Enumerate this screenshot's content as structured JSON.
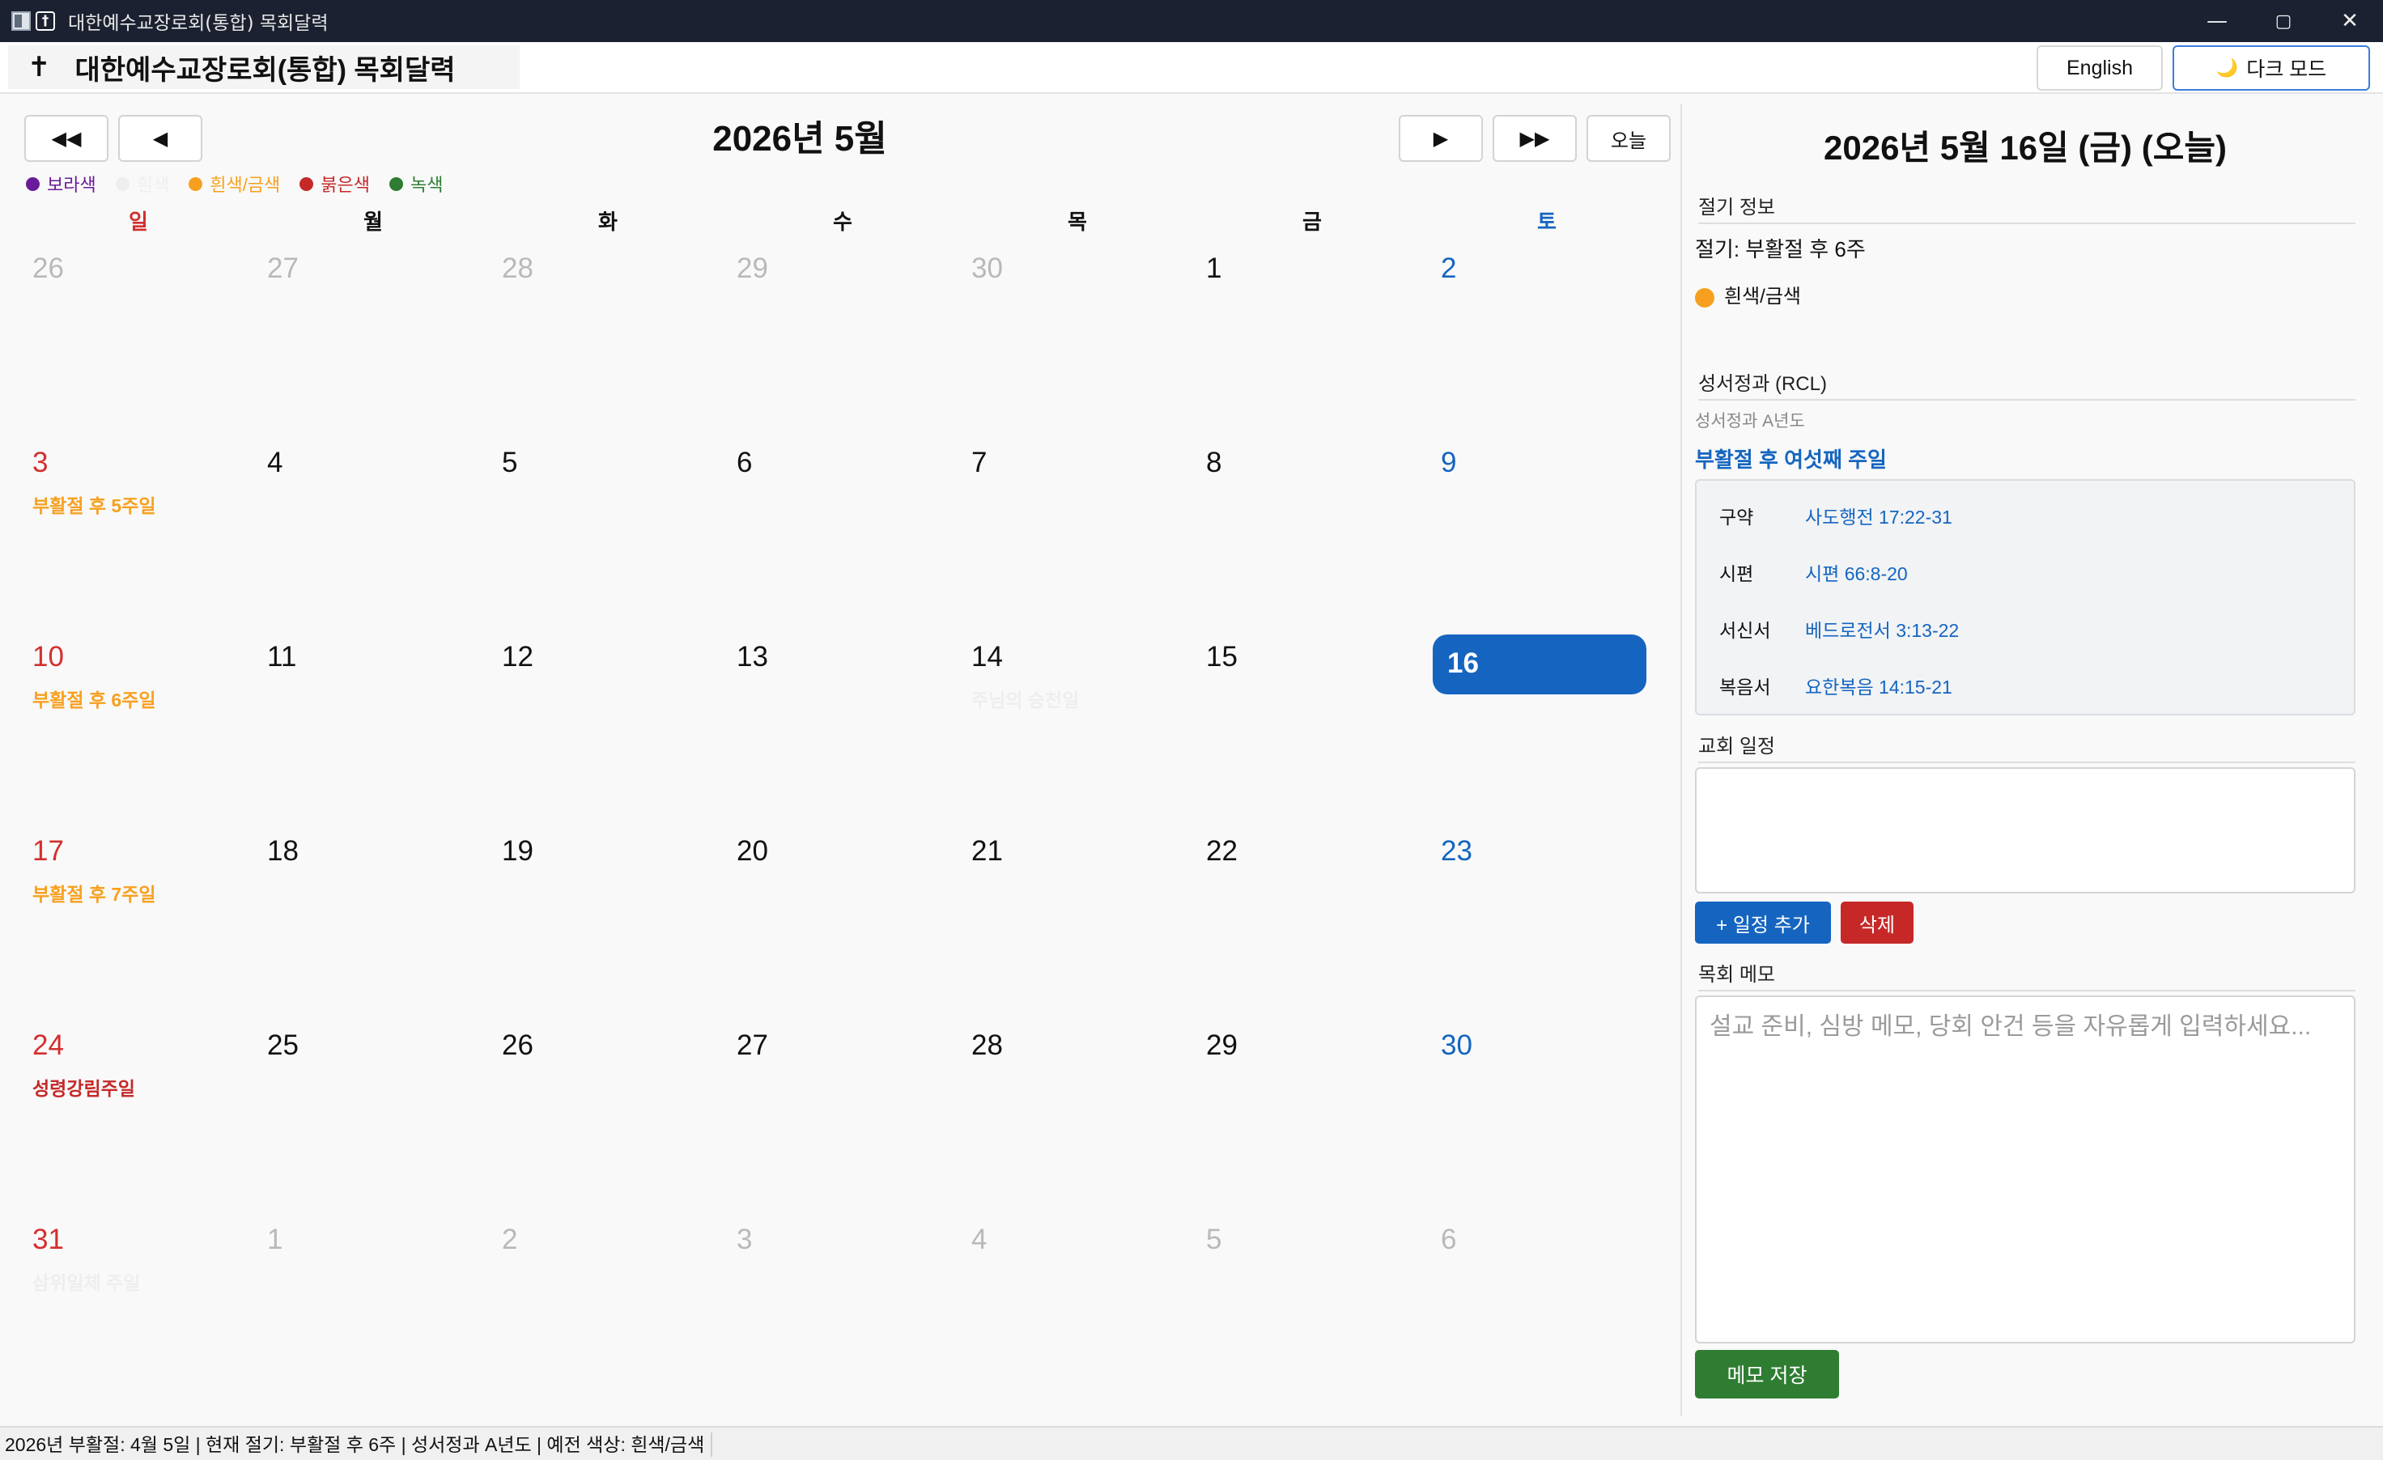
{
  "window": {
    "title": "대한예수교장로회(통합) 목회달력",
    "min": "—",
    "max": "▢",
    "close": "✕"
  },
  "header": {
    "cross": "✝",
    "title": "대한예수교장로회(통합) 목회달력",
    "english_label": "English",
    "dark_mode_icon": "🌙",
    "dark_mode_label": "다크 모드"
  },
  "calendar": {
    "month_title": "2026년 5월",
    "nav": {
      "prev_year": "◀◀",
      "prev_month": "◀",
      "next_month": "▶",
      "next_year": "▶▶",
      "today": "오늘"
    },
    "legend": [
      {
        "label": "보라색",
        "color": "#6a1b9a"
      },
      {
        "label": "흰색",
        "color": "#eeeeee"
      },
      {
        "label": "흰색/금색",
        "color": "#f7a01f"
      },
      {
        "label": "붉은색",
        "color": "#c62828"
      },
      {
        "label": "녹색",
        "color": "#2e7d32"
      }
    ],
    "weekdays": [
      "일",
      "월",
      "화",
      "수",
      "목",
      "금",
      "토"
    ],
    "weekday_colors": [
      "#d32f2f",
      "#111111",
      "#111111",
      "#111111",
      "#111111",
      "#111111",
      "#1565c0"
    ],
    "weeks": [
      [
        {
          "d": "26",
          "other": true
        },
        {
          "d": "27",
          "other": true
        },
        {
          "d": "28",
          "other": true
        },
        {
          "d": "29",
          "other": true
        },
        {
          "d": "30",
          "other": true
        },
        {
          "d": "1"
        },
        {
          "d": "2"
        }
      ],
      [
        {
          "d": "3",
          "label": "부활절 후 5주일",
          "label_color": "#f7a01f"
        },
        {
          "d": "4"
        },
        {
          "d": "5"
        },
        {
          "d": "6"
        },
        {
          "d": "7"
        },
        {
          "d": "8"
        },
        {
          "d": "9"
        }
      ],
      [
        {
          "d": "10",
          "label": "부활절 후 6주일",
          "label_color": "#f7a01f"
        },
        {
          "d": "11"
        },
        {
          "d": "12"
        },
        {
          "d": "13"
        },
        {
          "d": "14",
          "label": "주님의 승천일",
          "label_color": "#eeeeee"
        },
        {
          "d": "15"
        },
        {
          "d": "16",
          "today": true
        }
      ],
      [
        {
          "d": "17",
          "label": "부활절 후 7주일",
          "label_color": "#f7a01f"
        },
        {
          "d": "18"
        },
        {
          "d": "19"
        },
        {
          "d": "20"
        },
        {
          "d": "21"
        },
        {
          "d": "22"
        },
        {
          "d": "23"
        }
      ],
      [
        {
          "d": "24",
          "label": "성령강림주일",
          "label_color": "#c62828"
        },
        {
          "d": "25"
        },
        {
          "d": "26"
        },
        {
          "d": "27"
        },
        {
          "d": "28"
        },
        {
          "d": "29"
        },
        {
          "d": "30"
        }
      ],
      [
        {
          "d": "31",
          "label": "삼위일체 주일",
          "label_color": "#eeeeee"
        },
        {
          "d": "1",
          "other": true
        },
        {
          "d": "2",
          "other": true
        },
        {
          "d": "3",
          "other": true
        },
        {
          "d": "4",
          "other": true
        },
        {
          "d": "5",
          "other": true
        },
        {
          "d": "6",
          "other": true
        }
      ]
    ]
  },
  "panel": {
    "date_title": "2026년 5월 16일 (금) (오늘)",
    "season_section": "절기 정보",
    "season_text": "절기: 부활절 후 6주",
    "season_color_label": "흰색/금색",
    "season_color": "#f7a01f",
    "lectionary_section": "성서정과 (RCL)",
    "lectionary_year": "성서정과 A년도",
    "sunday_name": "부활절 후 여섯째 주일",
    "readings": [
      {
        "label": "구약",
        "value": "사도행전 17:22-31"
      },
      {
        "label": "시편",
        "value": "시편 66:8-20"
      },
      {
        "label": "서신서",
        "value": "베드로전서 3:13-22"
      },
      {
        "label": "복음서",
        "value": "요한복음 14:15-21"
      }
    ],
    "events_section": "교회 일정",
    "add_event": "+ 일정 추가",
    "delete": "삭제",
    "memo_section": "목회 메모",
    "memo_placeholder": "설교 준비, 심방 메모, 당회 안건 등을 자유롭게 입력하세요...",
    "save_memo": "메모 저장"
  },
  "status": {
    "text": "2026년 부활절: 4월 5일  |  현재 절기: 부활절 후 6주  |  성서정과 A년도  |  예전 색상: 흰색/금색"
  }
}
